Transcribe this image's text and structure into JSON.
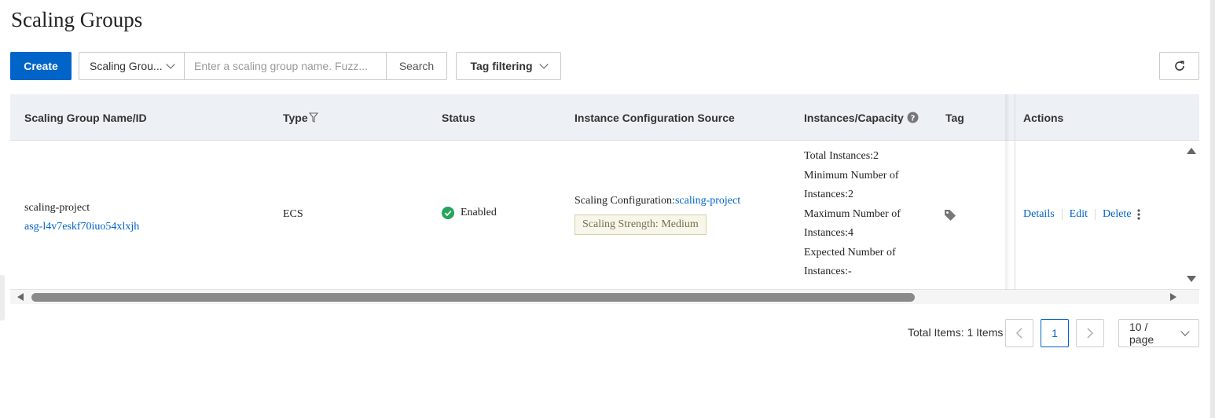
{
  "page": {
    "title": "Scaling Groups"
  },
  "toolbar": {
    "create_label": "Create",
    "search_field_select": "Scaling Grou...",
    "search_placeholder": "Enter a scaling group name. Fuzz...",
    "search_button": "Search",
    "tag_filter_label": "Tag filtering",
    "refresh_icon": "refresh-icon"
  },
  "table": {
    "columns": [
      "Scaling Group Name/ID",
      "Type",
      "Status",
      "Instance Configuration Source",
      "Instances/Capacity",
      "Tag",
      "Actions"
    ],
    "rows": [
      {
        "name": "scaling-project",
        "id": "asg-l4v7eskf70iuo54xlxjh",
        "type": "ECS",
        "status": "Enabled",
        "config_prefix": "Scaling Configuration:",
        "config_link": "scaling-project",
        "strength_badge": "Scaling Strength: Medium",
        "capacity": {
          "total": "Total Instances:2",
          "min_line1": "Minimum Number of",
          "min_line2": "Instances:2",
          "max_line1": "Maximum Number of",
          "max_line2": "Instances:4",
          "expected_line1": "Expected Number of",
          "expected_line2": "Instances:-"
        },
        "actions": [
          "Details",
          "Edit",
          "Delete"
        ]
      }
    ]
  },
  "pagination": {
    "total_label": "Total Items: 1 Items",
    "current_page": "1",
    "page_size": "10 / page"
  },
  "colors": {
    "primary": "#0064c8",
    "success": "#23a55a",
    "header_bg": "#edf1f6"
  }
}
